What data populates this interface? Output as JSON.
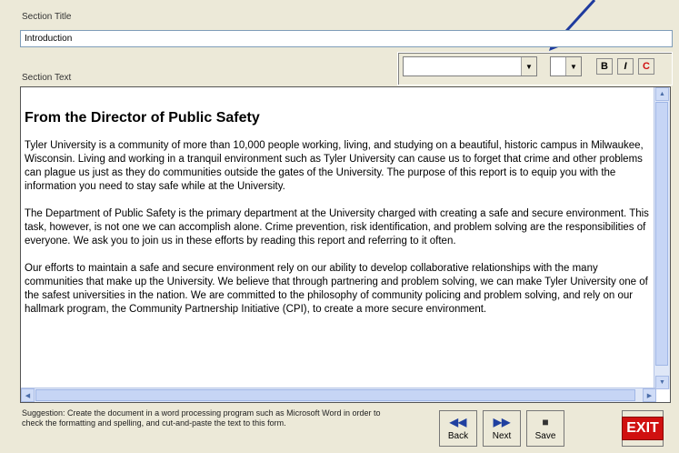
{
  "section_title": {
    "label": "Section Title",
    "value": "Introduction"
  },
  "section_text": {
    "label": "Section Text",
    "heading": "From the Director of Public Safety",
    "paragraphs": [
      "Tyler University is a community of more than 10,000 people working, living, and studying on a beautiful, historic campus in Milwaukee, Wisconsin. Living and working in a tranquil environment such as Tyler University can cause us to forget that crime and other problems can plague us just as they do communities outside the gates of the University. The purpose of this report is to equip you with the information you need to stay safe while at the University.",
      "The Department of Public Safety is the primary department at the University charged with creating a safe and secure environment. This task, however, is not one we can accomplish alone. Crime prevention, risk identification, and problem solving are the responsibilities of everyone. We ask you to join us in these efforts by reading this report and referring to it often.",
      "Our efforts to maintain a safe and secure environment rely on our ability to develop collaborative relationships with the many communities that make up the University. We believe that through partnering and problem solving, we can make Tyler University one of the safest universities in the nation. We are committed to the philosophy of community policing and problem solving, and rely on our hallmark program, the Community Partnership Initiative (CPI), to create a more secure environment."
    ]
  },
  "toolbar": {
    "font_value": "",
    "size_value": "",
    "bold_label": "B",
    "italic_label": "I",
    "color_label": "C"
  },
  "suggestion": "Suggestion: Create the document in a word processing program such as Microsoft Word in order to check the formatting and spelling, and cut-and-paste the text to this form.",
  "buttons": {
    "back": "Back",
    "next": "Next",
    "save": "Save",
    "exit": "EXIT"
  },
  "colors": {
    "arrow": "#1f3b9e",
    "exit_bg": "#d01010",
    "scroll": "#dfe7f7"
  }
}
